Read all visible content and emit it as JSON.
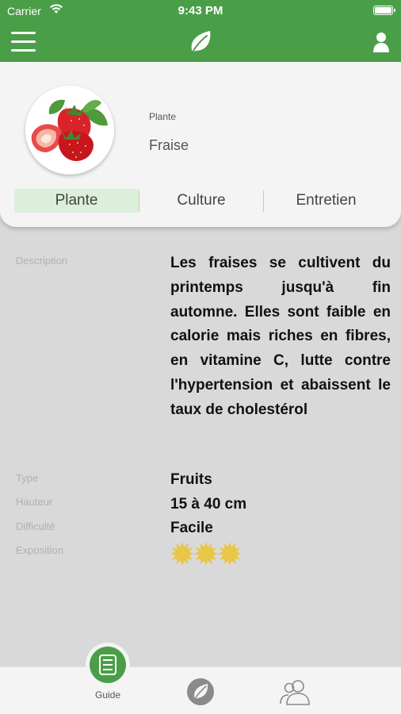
{
  "status_bar": {
    "carrier": "Carrier",
    "time": "9:43 PM"
  },
  "nav": {
    "menu_icon": "hamburger-icon",
    "logo_icon": "leaf-icon",
    "profile_icon": "user-icon"
  },
  "plant": {
    "kind_label": "Plante",
    "name": "Fraise",
    "image": "strawberry"
  },
  "tabs": [
    {
      "label": "Plante",
      "active": true
    },
    {
      "label": "Culture",
      "active": false
    },
    {
      "label": "Entretien",
      "active": false
    }
  ],
  "description": {
    "label": "Description",
    "text": "Les fraises se cultivent du printemps jusqu'à fin automne. Elles sont faible en calorie mais riches en fibres, en vitamine C, lutte contre l'hypertension et abaissent le taux de cholestérol"
  },
  "properties": {
    "type": {
      "label": "Type",
      "value": "Fruits"
    },
    "hauteur": {
      "label": "Hauteur",
      "value": "15 à 40 cm"
    },
    "difficulte": {
      "label": "Difficulté",
      "value": "Facile"
    },
    "exposition": {
      "label": "Exposition",
      "suns": 3,
      "max": 3
    }
  },
  "bottom_bar": {
    "guide_label": "Guide",
    "guide_icon": "list-icon",
    "plants_icon": "leaf-icon",
    "community_icon": "users-icon"
  },
  "colors": {
    "primary": "#4a9e48",
    "active_tab": "#dcefdb",
    "sun": "#e8c647",
    "background": "#d9d9d9"
  }
}
